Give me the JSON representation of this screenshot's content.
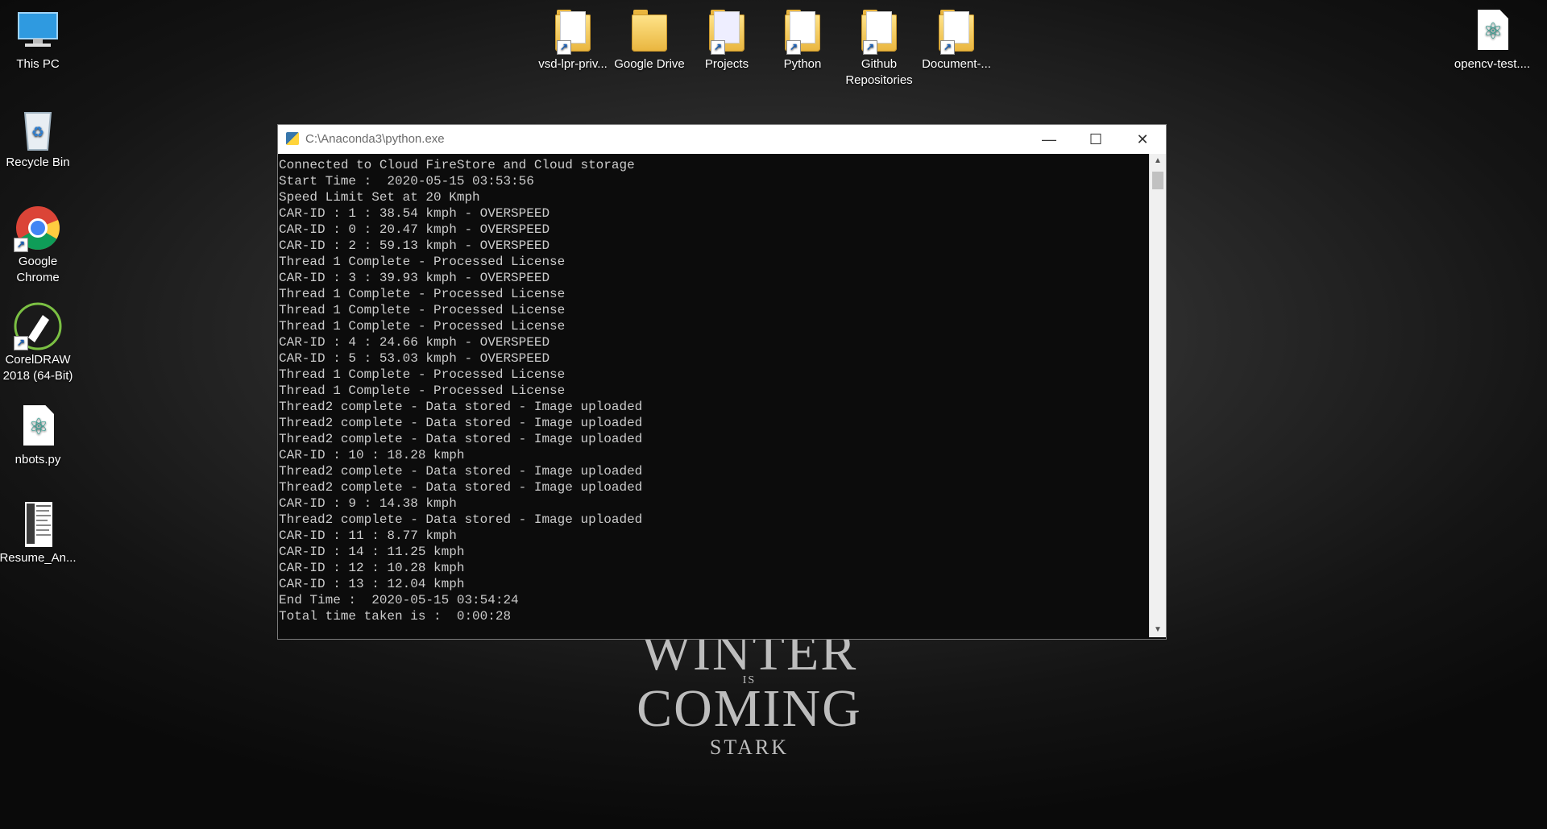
{
  "wallpaper": {
    "line1": "WINTER",
    "line2": "IS",
    "line3": "COMING",
    "line4": "STARK"
  },
  "desktop_icons": {
    "this_pc": "This PC",
    "recycle_bin": "Recycle Bin",
    "chrome_line1": "Google",
    "chrome_line2": "Chrome",
    "coreldraw_line1": "CorelDRAW",
    "coreldraw_line2": "2018 (64-Bit)",
    "nbots": "nbots.py",
    "resume": "Resume_An...",
    "vsd": "vsd-lpr-priv...",
    "google_drive": "Google Drive",
    "projects": "Projects",
    "python": "Python",
    "github_line1": "Github",
    "github_line2": "Repositories",
    "document": "Document-...",
    "opencv": "opencv-test...."
  },
  "window": {
    "title": "C:\\Anaconda3\\python.exe",
    "minimize_icon": "minimize-icon",
    "maximize_icon": "maximize-icon",
    "close_icon": "close-icon",
    "lines": [
      "Connected to Cloud FireStore and Cloud storage",
      "Start Time :  2020-05-15 03:53:56",
      "Speed Limit Set at 20 Kmph",
      "CAR-ID : 1 : 38.54 kmph - OVERSPEED",
      "CAR-ID : 0 : 20.47 kmph - OVERSPEED",
      "CAR-ID : 2 : 59.13 kmph - OVERSPEED",
      "Thread 1 Complete - Processed License",
      "CAR-ID : 3 : 39.93 kmph - OVERSPEED",
      "Thread 1 Complete - Processed License",
      "Thread 1 Complete - Processed License",
      "Thread 1 Complete - Processed License",
      "CAR-ID : 4 : 24.66 kmph - OVERSPEED",
      "CAR-ID : 5 : 53.03 kmph - OVERSPEED",
      "Thread 1 Complete - Processed License",
      "Thread 1 Complete - Processed License",
      "Thread2 complete - Data stored - Image uploaded",
      "Thread2 complete - Data stored - Image uploaded",
      "Thread2 complete - Data stored - Image uploaded",
      "CAR-ID : 10 : 18.28 kmph",
      "Thread2 complete - Data stored - Image uploaded",
      "Thread2 complete - Data stored - Image uploaded",
      "CAR-ID : 9 : 14.38 kmph",
      "Thread2 complete - Data stored - Image uploaded",
      "CAR-ID : 11 : 8.77 kmph",
      "CAR-ID : 14 : 11.25 kmph",
      "CAR-ID : 12 : 10.28 kmph",
      "CAR-ID : 13 : 12.04 kmph",
      "End Time :  2020-05-15 03:54:24",
      "Total time taken is :  0:00:28"
    ]
  },
  "colors": {
    "console_bg": "#0c0c0c",
    "console_text": "#cccccc",
    "titlebar_bg": "#ffffff",
    "folder_yellow": "#e9b53e"
  }
}
